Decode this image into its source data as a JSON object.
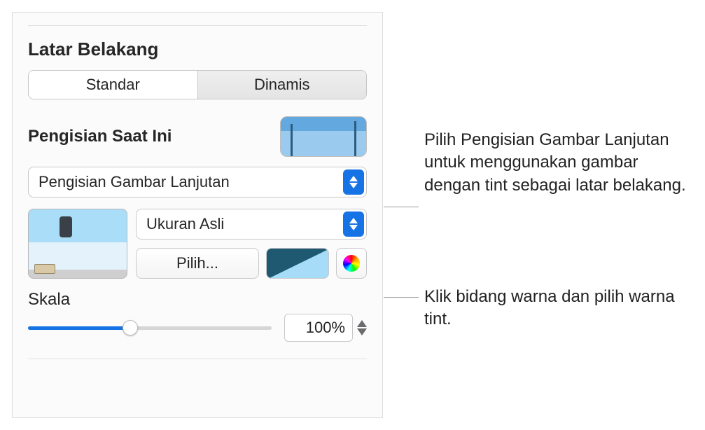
{
  "panel": {
    "section_title": "Latar Belakang",
    "tabs": {
      "standard": "Standar",
      "dynamic": "Dinamis"
    },
    "current_fill_label": "Pengisian Saat Ini",
    "fill_type": "Pengisian Gambar Lanjutan",
    "size_mode": "Ukuran Asli",
    "choose_button": "Pilih...",
    "scale_label": "Skala",
    "scale_value": "100%",
    "tint_color": "#1e5871",
    "tint_light": "#a6dcf7"
  },
  "callouts": {
    "c1": "Pilih Pengisian Gambar Lanjutan untuk menggunakan gambar dengan tint sebagai latar belakang.",
    "c2": "Klik bidang warna dan pilih warna tint."
  }
}
